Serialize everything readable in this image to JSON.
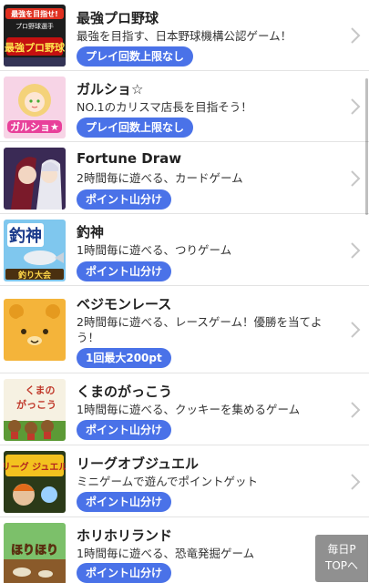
{
  "items": [
    {
      "title": "最強プロ野球",
      "desc": "最強を目指す、日本野球機構公認ゲーム！",
      "tag": "プレイ回数上限なし",
      "icon": "baseball-game-icon"
    },
    {
      "title": "ガルショ☆",
      "desc": "NO.1のカリスマ店長を目指そう！",
      "tag": "プレイ回数上限なし",
      "icon": "garusho-game-icon"
    },
    {
      "title": "Fortune Draw",
      "desc": "2時間毎に遊べる、カードゲーム",
      "tag": "ポイント山分け",
      "icon": "fortune-draw-icon"
    },
    {
      "title": "釣神",
      "desc": "1時間毎に遊べる、つりゲーム",
      "tag": "ポイント山分け",
      "icon": "fishing-game-icon"
    },
    {
      "title": "ベジモンレース",
      "desc": "2時間毎に遊べる、レースゲーム！優勝を当てよう！",
      "tag": "1回最大200pt",
      "icon": "vegimon-race-icon"
    },
    {
      "title": "くまのがっこう",
      "desc": "1時間毎に遊べる、クッキーを集めるゲーム",
      "tag": "ポイント山分け",
      "icon": "bear-school-icon"
    },
    {
      "title": "リーグオブジュエル",
      "desc": "ミニゲームで遊んでポイントゲット",
      "tag": "ポイント山分け",
      "icon": "league-of-jewel-icon"
    },
    {
      "title": "ホリホリランド",
      "desc": "1時間毎に遊べる、恐竜発掘ゲーム",
      "tag": "ポイント山分け",
      "icon": "horihori-land-icon"
    }
  ],
  "thumb_text": {
    "baseball_banner": "最強を目指せ!",
    "baseball_sub": "プロ野球選手",
    "baseball_logo": "最強プロ野球",
    "garusho_logo": "ガルショ★",
    "fishing_logo": "釣神",
    "fishing_sub": "釣り大会",
    "bear_logo_1": "くまの",
    "bear_logo_2": "がっこう",
    "jewel_logo": "リーグ ジュエル",
    "horihori_logo": "ほりほり"
  },
  "float_button": {
    "line1": "毎日P",
    "line2": "TOPへ"
  },
  "colors": {
    "accent": "#4a72e8",
    "divider": "#e3e3e3"
  }
}
